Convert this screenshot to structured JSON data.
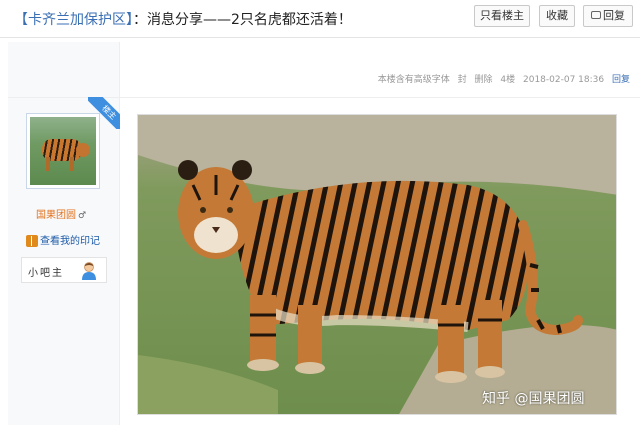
{
  "header": {
    "title_forum": "【卡齐兰加保护区】",
    "title_rest": "：消息分享——2只名虎都还活着！",
    "btn_only_op": "只看楼主",
    "btn_favorite": "收藏",
    "btn_reply": "回复"
  },
  "post_meta": {
    "floor_info": "本楼含有高级字体",
    "seal": "封",
    "delete": "删除",
    "floor": "4楼",
    "timestamp": "2018-02-07 18:36",
    "reply": "回复"
  },
  "author": {
    "badge": "楼主",
    "name": "国果团圆",
    "gender": "♂",
    "marks_link": "查看我的印记",
    "role": "小吧主"
  },
  "watermark": "知乎 @国果团圆",
  "colors": {
    "link": "#1d5ba8",
    "username": "#e2731e",
    "badge": "#3f8fe0"
  }
}
